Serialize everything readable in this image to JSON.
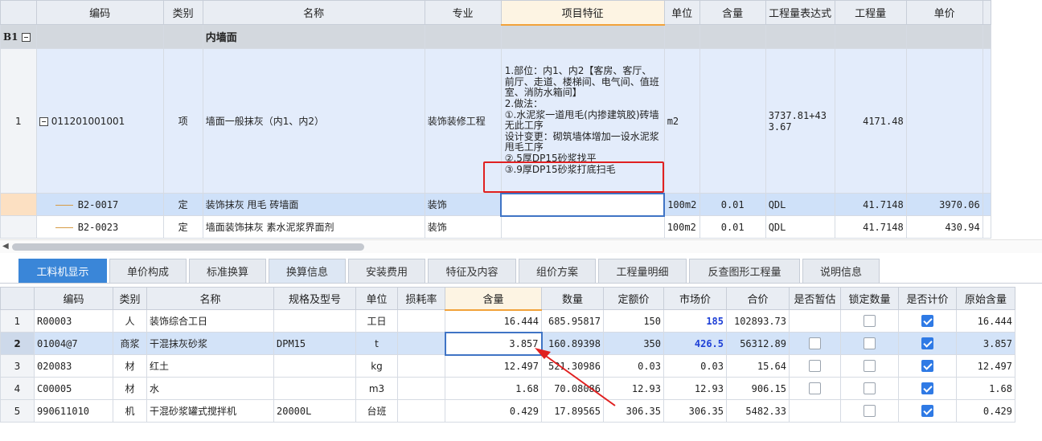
{
  "top": {
    "columns": [
      "编码",
      "类别",
      "名称",
      "专业",
      "项目特征",
      "单位",
      "含量",
      "工程量表达式",
      "工程量",
      "单价"
    ],
    "b1_row": {
      "label": "B1",
      "name": "内墙面"
    },
    "item_row": {
      "rownum": "1",
      "code": "011201001001",
      "type": "项",
      "name": "墙面一般抹灰（内1、内2）",
      "major": "装饰装修工程",
      "features": [
        "1.部位：内1、内2【客房、客厅、前厅、走道、楼梯间、电气间、值班室、消防水箱间】",
        "2.做法：",
        "①.水泥浆一道甩毛(内掺建筑胶)砖墙无此工序",
        "设计变更：砌筑墙体增加一设水泥浆甩毛工序",
        "②.5厚DP15砂浆找平",
        "③.9厚DP15砂浆打底扫毛"
      ],
      "unit": "m2",
      "expr": "3737.81+433.67",
      "qty": "4171.48"
    },
    "sub_rows": [
      {
        "code": "B2-0017",
        "type": "定",
        "name": "装饰抹灰 甩毛 砖墙面",
        "major": "装饰",
        "unit": "100m2",
        "content": "0.01",
        "expr": "QDL",
        "qty": "41.7148",
        "price": "3970.06"
      },
      {
        "code": "B2-0023",
        "type": "定",
        "name": "墙面装饰抹灰 素水泥浆界面剂",
        "major": "装饰",
        "unit": "100m2",
        "content": "0.01",
        "expr": "QDL",
        "qty": "41.7148",
        "price": "430.94"
      }
    ]
  },
  "tabs": [
    "工料机显示",
    "单价构成",
    "标准换算",
    "换算信息",
    "安装费用",
    "特征及内容",
    "组价方案",
    "工程量明细",
    "反查图形工程量",
    "说明信息"
  ],
  "bottom": {
    "columns": [
      "编码",
      "类别",
      "名称",
      "规格及型号",
      "单位",
      "损耗率",
      "含量",
      "数量",
      "定额价",
      "市场价",
      "合价",
      "是否暂估",
      "锁定数量",
      "是否计价",
      "原始含量"
    ],
    "rows": [
      {
        "n": "1",
        "code": "R00003",
        "type": "人",
        "name": "装饰综合工日",
        "spec": "",
        "unit": "工日",
        "loss": "",
        "content": "16.444",
        "qty": "685.95817",
        "quota": "150",
        "market": "185",
        "total": "102893.73",
        "provisional": null,
        "locked": false,
        "priced": true,
        "orig": "16.444"
      },
      {
        "n": "2",
        "code": "01004@7",
        "type": "商浆",
        "name": "干混抹灰砂浆",
        "spec": "DPM15",
        "unit": "t",
        "loss": "",
        "content": "3.857",
        "qty": "160.89398",
        "quota": "350",
        "market": "426.5",
        "total": "56312.89",
        "provisional": false,
        "locked": false,
        "priced": true,
        "orig": "3.857"
      },
      {
        "n": "3",
        "code": "020083",
        "type": "材",
        "name": "红土",
        "spec": "",
        "unit": "kg",
        "loss": "",
        "content": "12.497",
        "qty": "521.30986",
        "quota": "0.03",
        "market": "0.03",
        "total": "15.64",
        "provisional": false,
        "locked": false,
        "priced": true,
        "orig": "12.497"
      },
      {
        "n": "4",
        "code": "C00005",
        "type": "材",
        "name": "水",
        "spec": "",
        "unit": "m3",
        "loss": "",
        "content": "1.68",
        "qty": "70.08086",
        "quota": "12.93",
        "market": "12.93",
        "total": "906.15",
        "provisional": false,
        "locked": false,
        "priced": true,
        "orig": "1.68"
      },
      {
        "n": "5",
        "code": "990611010",
        "type": "机",
        "name": "干混砂浆罐式搅拌机",
        "spec": "20000L",
        "unit": "台班",
        "loss": "",
        "content": "0.429",
        "qty": "17.89565",
        "quota": "306.35",
        "market": "306.35",
        "total": "5482.33",
        "provisional": null,
        "locked": false,
        "priced": true,
        "orig": "0.429"
      }
    ]
  },
  "colors": {
    "accent": "#3a86d8",
    "annotation": "#e02020",
    "header": "#e9edf3",
    "selection": "#cfe1f9"
  }
}
